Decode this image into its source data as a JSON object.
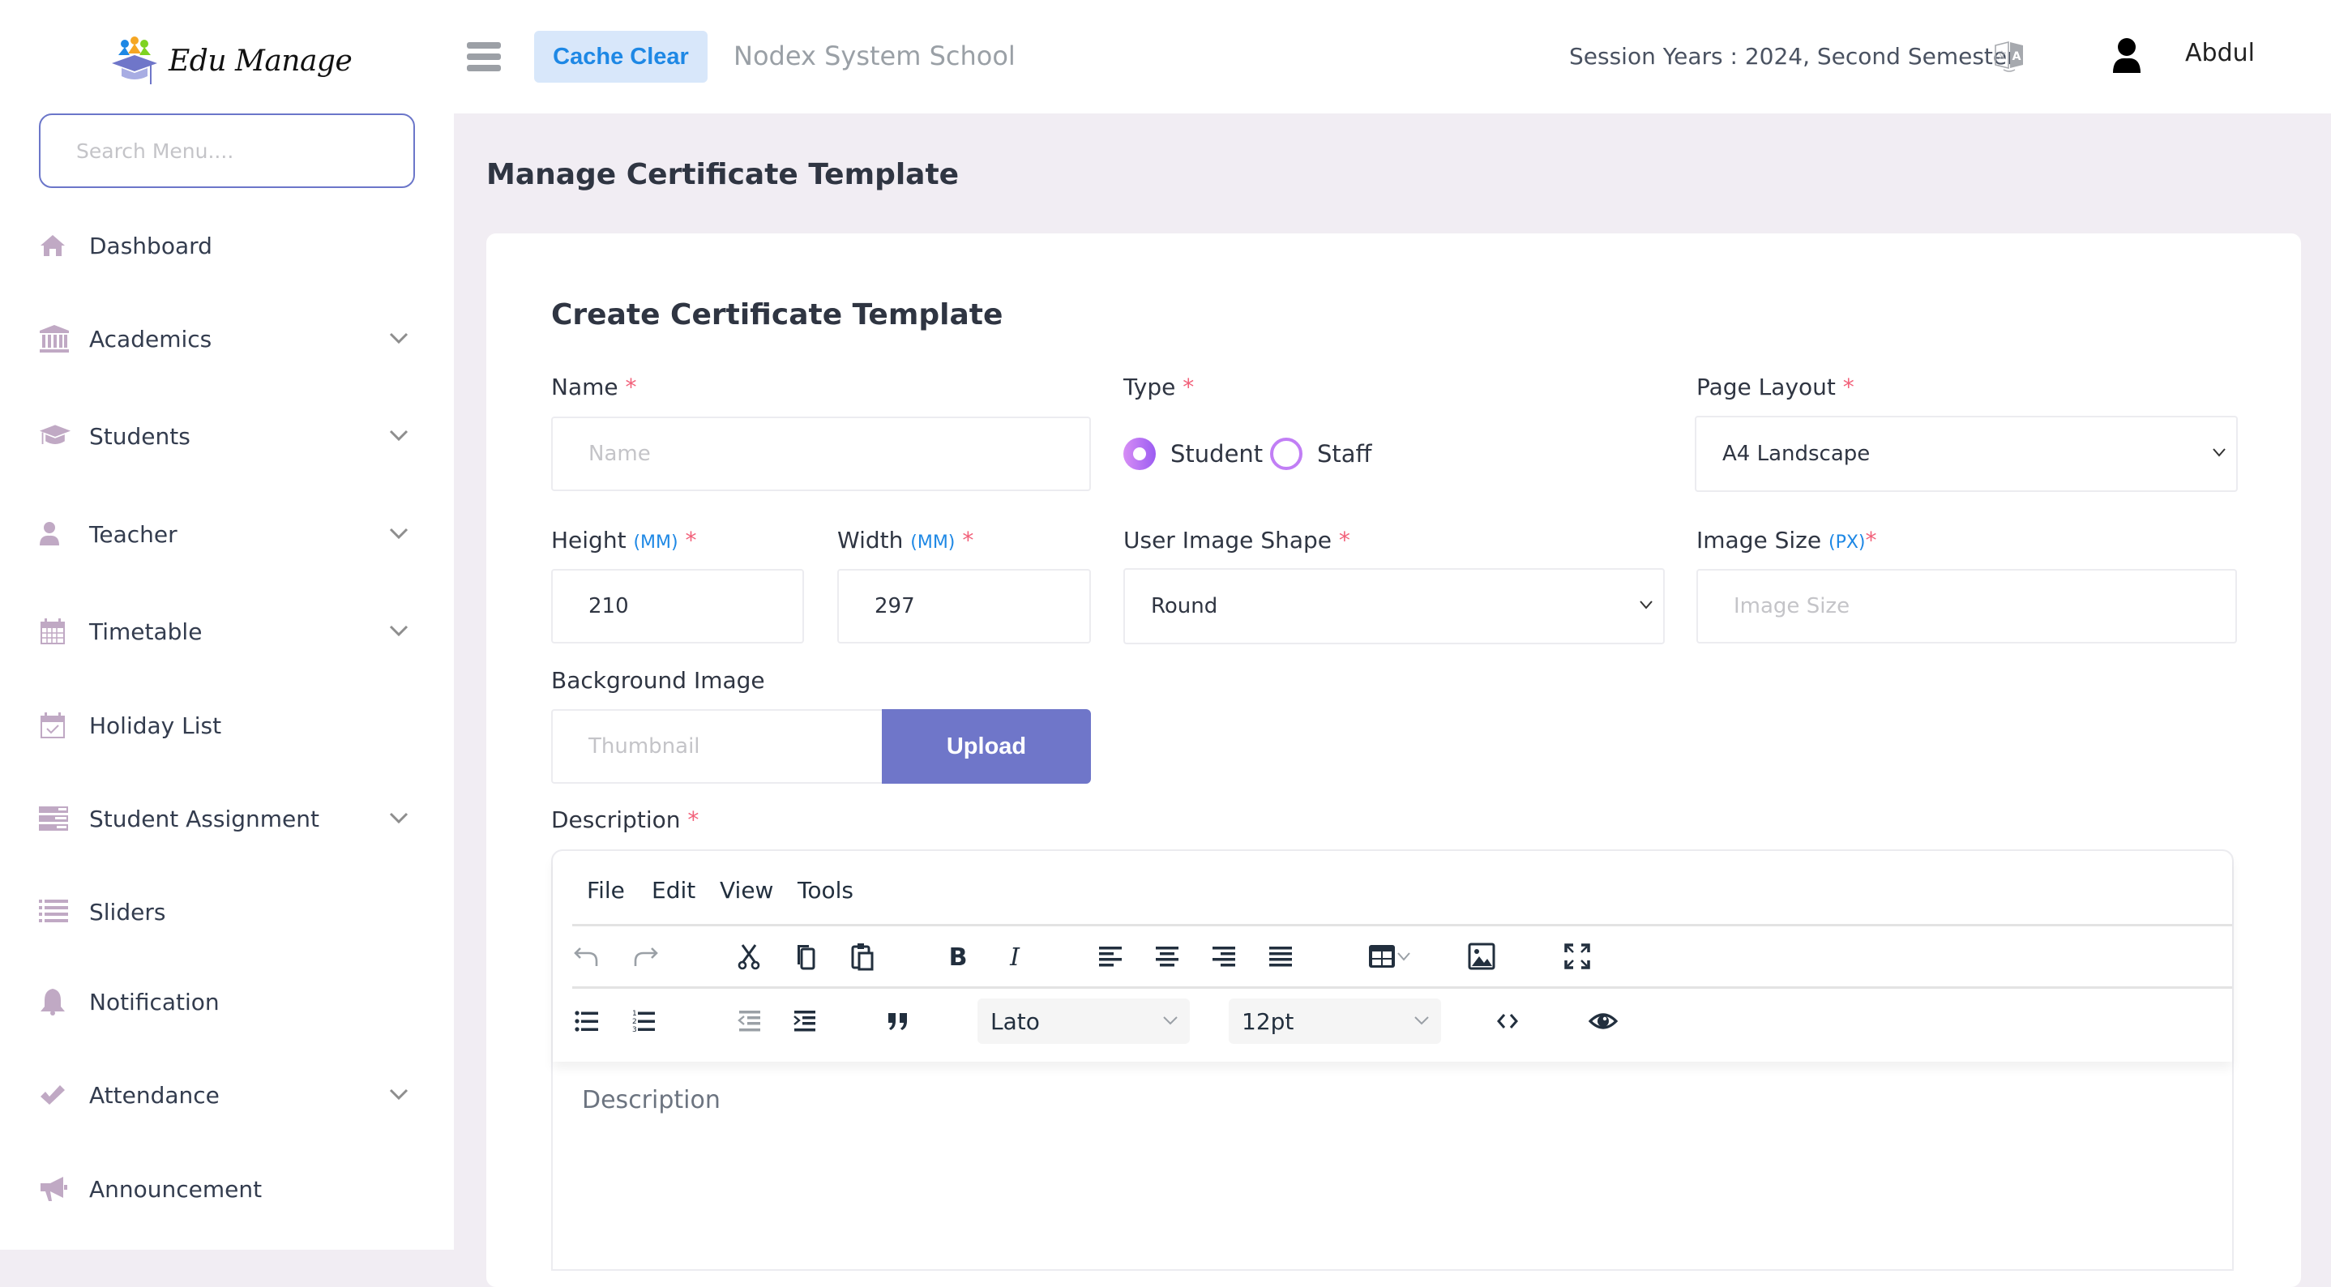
{
  "header": {
    "logo_text": "Edu Manage",
    "cache_button": "Cache Clear",
    "school_name": "Nodex System School",
    "session": "Session Years : 2024, Second Semester",
    "username": "Abdul",
    "icons": [
      "menu-icon",
      "translate-icon",
      "user-icon"
    ]
  },
  "sidebar": {
    "search_placeholder": "Search Menu....",
    "items": [
      {
        "label": "Dashboard",
        "icon": "home-icon",
        "expandable": false
      },
      {
        "label": "Academics",
        "icon": "institution-icon",
        "expandable": true
      },
      {
        "label": "Students",
        "icon": "graduation-cap-icon",
        "expandable": true
      },
      {
        "label": "Teacher",
        "icon": "user-icon",
        "expandable": true
      },
      {
        "label": "Timetable",
        "icon": "calendar-icon",
        "expandable": true
      },
      {
        "label": "Holiday List",
        "icon": "calendar-check-icon",
        "expandable": false
      },
      {
        "label": "Student Assignment",
        "icon": "tasks-icon",
        "expandable": true
      },
      {
        "label": "Sliders",
        "icon": "list-icon",
        "expandable": false
      },
      {
        "label": "Notification",
        "icon": "bell-icon",
        "expandable": false
      },
      {
        "label": "Attendance",
        "icon": "check-icon",
        "expandable": true
      },
      {
        "label": "Announcement",
        "icon": "megaphone-icon",
        "expandable": false
      }
    ]
  },
  "page": {
    "title": "Manage Certificate Template",
    "card_title": "Create Certificate Template"
  },
  "form": {
    "required_mark": "*",
    "name": {
      "label": "Name",
      "placeholder": "Name",
      "value": ""
    },
    "type": {
      "label": "Type",
      "options": [
        "Student",
        "Staff"
      ],
      "selected": "Student"
    },
    "page_layout": {
      "label": "Page Layout",
      "value": "A4 Landscape"
    },
    "height": {
      "label": "Height",
      "unit": "(MM)",
      "value": "210"
    },
    "width": {
      "label": "Width",
      "unit": "(MM)",
      "value": "297"
    },
    "user_image_shape": {
      "label": "User Image Shape",
      "value": "Round"
    },
    "image_size": {
      "label": "Image Size",
      "unit": "(PX)",
      "placeholder": "Image Size",
      "value": ""
    },
    "background_image": {
      "label": "Background Image",
      "placeholder": "Thumbnail",
      "upload_label": "Upload"
    },
    "description": {
      "label": "Description",
      "placeholder": "Description"
    }
  },
  "editor": {
    "menus": [
      "File",
      "Edit",
      "View",
      "Tools"
    ],
    "toolbar_row1": [
      "undo",
      "redo",
      "cut",
      "copy",
      "paste",
      "bold",
      "italic",
      "align-left",
      "align-center",
      "align-right",
      "align-justify",
      "table",
      "image",
      "fullscreen"
    ],
    "toolbar_row2": [
      "bullet-list",
      "numbered-list",
      "outdent",
      "indent",
      "blockquote",
      "font-family",
      "font-size",
      "source-code",
      "preview"
    ],
    "font_family": "Lato",
    "font_size": "12pt"
  },
  "colors": {
    "accent": "#6f76c9",
    "cache_bg": "#d8e7fa",
    "cache_text": "#1e88e5",
    "required": "#f2617a",
    "radio": "#b06ef5",
    "sidebar_icon": "#c0a9c4",
    "page_bg": "#f1edf3"
  }
}
